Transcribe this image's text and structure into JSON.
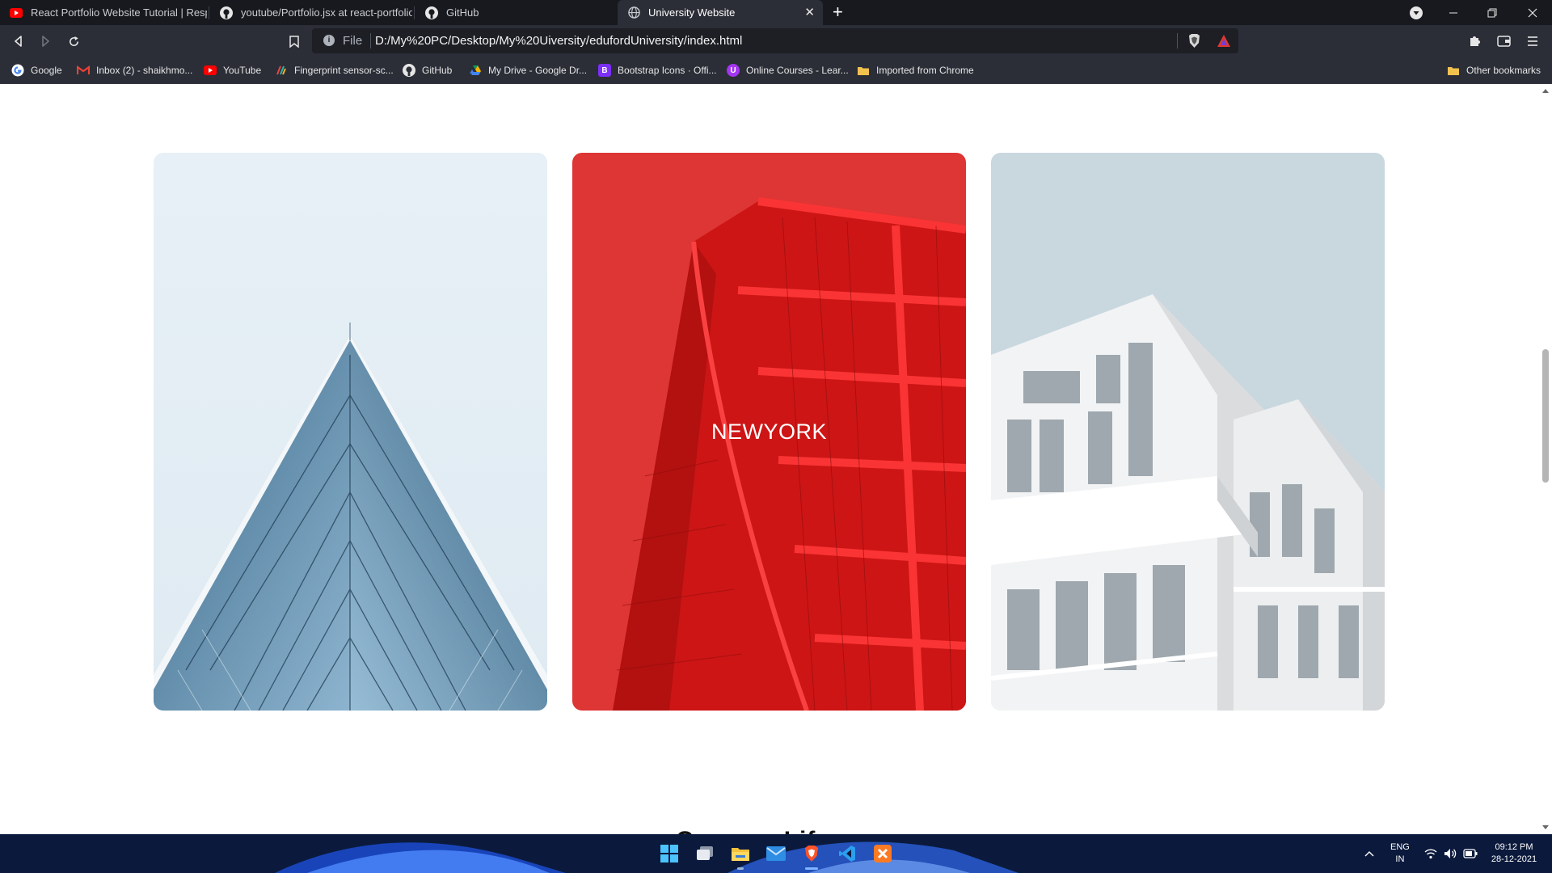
{
  "browser": {
    "tabs": [
      {
        "title": "React Portfolio Website Tutorial | Responsive",
        "icon": "youtube-icon",
        "active": false
      },
      {
        "title": "youtube/Portfolio.jsx at react-portfolio · sa",
        "icon": "github-icon",
        "active": false
      },
      {
        "title": "GitHub",
        "icon": "github-icon",
        "active": false
      },
      {
        "title": "University Website",
        "icon": "globe-icon",
        "active": true
      }
    ],
    "address": {
      "scheme": "File",
      "url": "D:/My%20PC/Desktop/My%20Uiversity/edufordUniversity/index.html"
    },
    "bookmarks": [
      {
        "label": "Google",
        "icon": "google-icon"
      },
      {
        "label": "Inbox (2) - shaikhmo...",
        "icon": "gmail-icon"
      },
      {
        "label": "YouTube",
        "icon": "youtube-icon"
      },
      {
        "label": "Fingerprint sensor-sc...",
        "icon": "fingerprint-icon"
      },
      {
        "label": "GitHub",
        "icon": "github-icon"
      },
      {
        "label": "My Drive - Google Dr...",
        "icon": "google-drive-icon"
      },
      {
        "label": "Bootstrap Icons · Offi...",
        "icon": "bootstrap-icon",
        "glyph": "B"
      },
      {
        "label": "Online Courses - Lear...",
        "icon": "udemy-icon",
        "glyph": "U"
      },
      {
        "label": "Imported from Chrome",
        "icon": "folder-icon"
      }
    ],
    "other_bookmarks": "Other bookmarks"
  },
  "page": {
    "cards": [
      {
        "name": "glass-pyramid-building",
        "label": ""
      },
      {
        "name": "red-tower-building",
        "label": "NEWYORK"
      },
      {
        "name": "white-apartment-building",
        "label": ""
      }
    ],
    "peek_heading": "Campus Life"
  },
  "taskbar": {
    "apps": [
      "windows-start-icon",
      "task-view-icon",
      "file-explorer-icon",
      "mail-icon",
      "brave-browser-icon",
      "vscode-icon",
      "xampp-icon"
    ],
    "language": {
      "line1": "ENG",
      "line2": "IN"
    },
    "time": "09:12 PM",
    "date": "28-12-2021"
  },
  "colors": {
    "card_overlay": "#e11d1d",
    "tab_active_bg": "#2b2e37",
    "tabstrip_bg": "#17191f"
  }
}
